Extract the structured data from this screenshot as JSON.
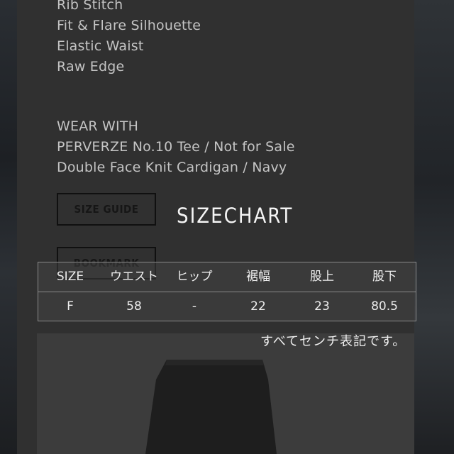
{
  "specs": {
    "lines": [
      "Rib Stitch",
      "Fit & Flare Silhouette",
      "Elastic Waist",
      "Raw Edge"
    ]
  },
  "wear_with": {
    "heading": "WEAR WITH",
    "items": [
      "PERVERZE No.10 Tee / Not for Sale",
      "Double Face Knit Cardigan / Navy"
    ]
  },
  "buttons": {
    "size_guide": "SIZE GUIDE",
    "bookmark": "BOOKMARK"
  },
  "sizechart": {
    "title": "SIZECHART",
    "headers": [
      "SIZE",
      "ウエスト",
      "ヒップ",
      "裾幅",
      "股上",
      "股下"
    ],
    "rows": [
      [
        "F",
        "58",
        "-",
        "22",
        "23",
        "80.5"
      ]
    ],
    "note": "すべてセンチ表記です。"
  },
  "colors": {
    "panel": "#303030",
    "text_muted": "#c4c4c4",
    "text_light": "#eeeeee",
    "table_border": "#8a8a8a"
  }
}
